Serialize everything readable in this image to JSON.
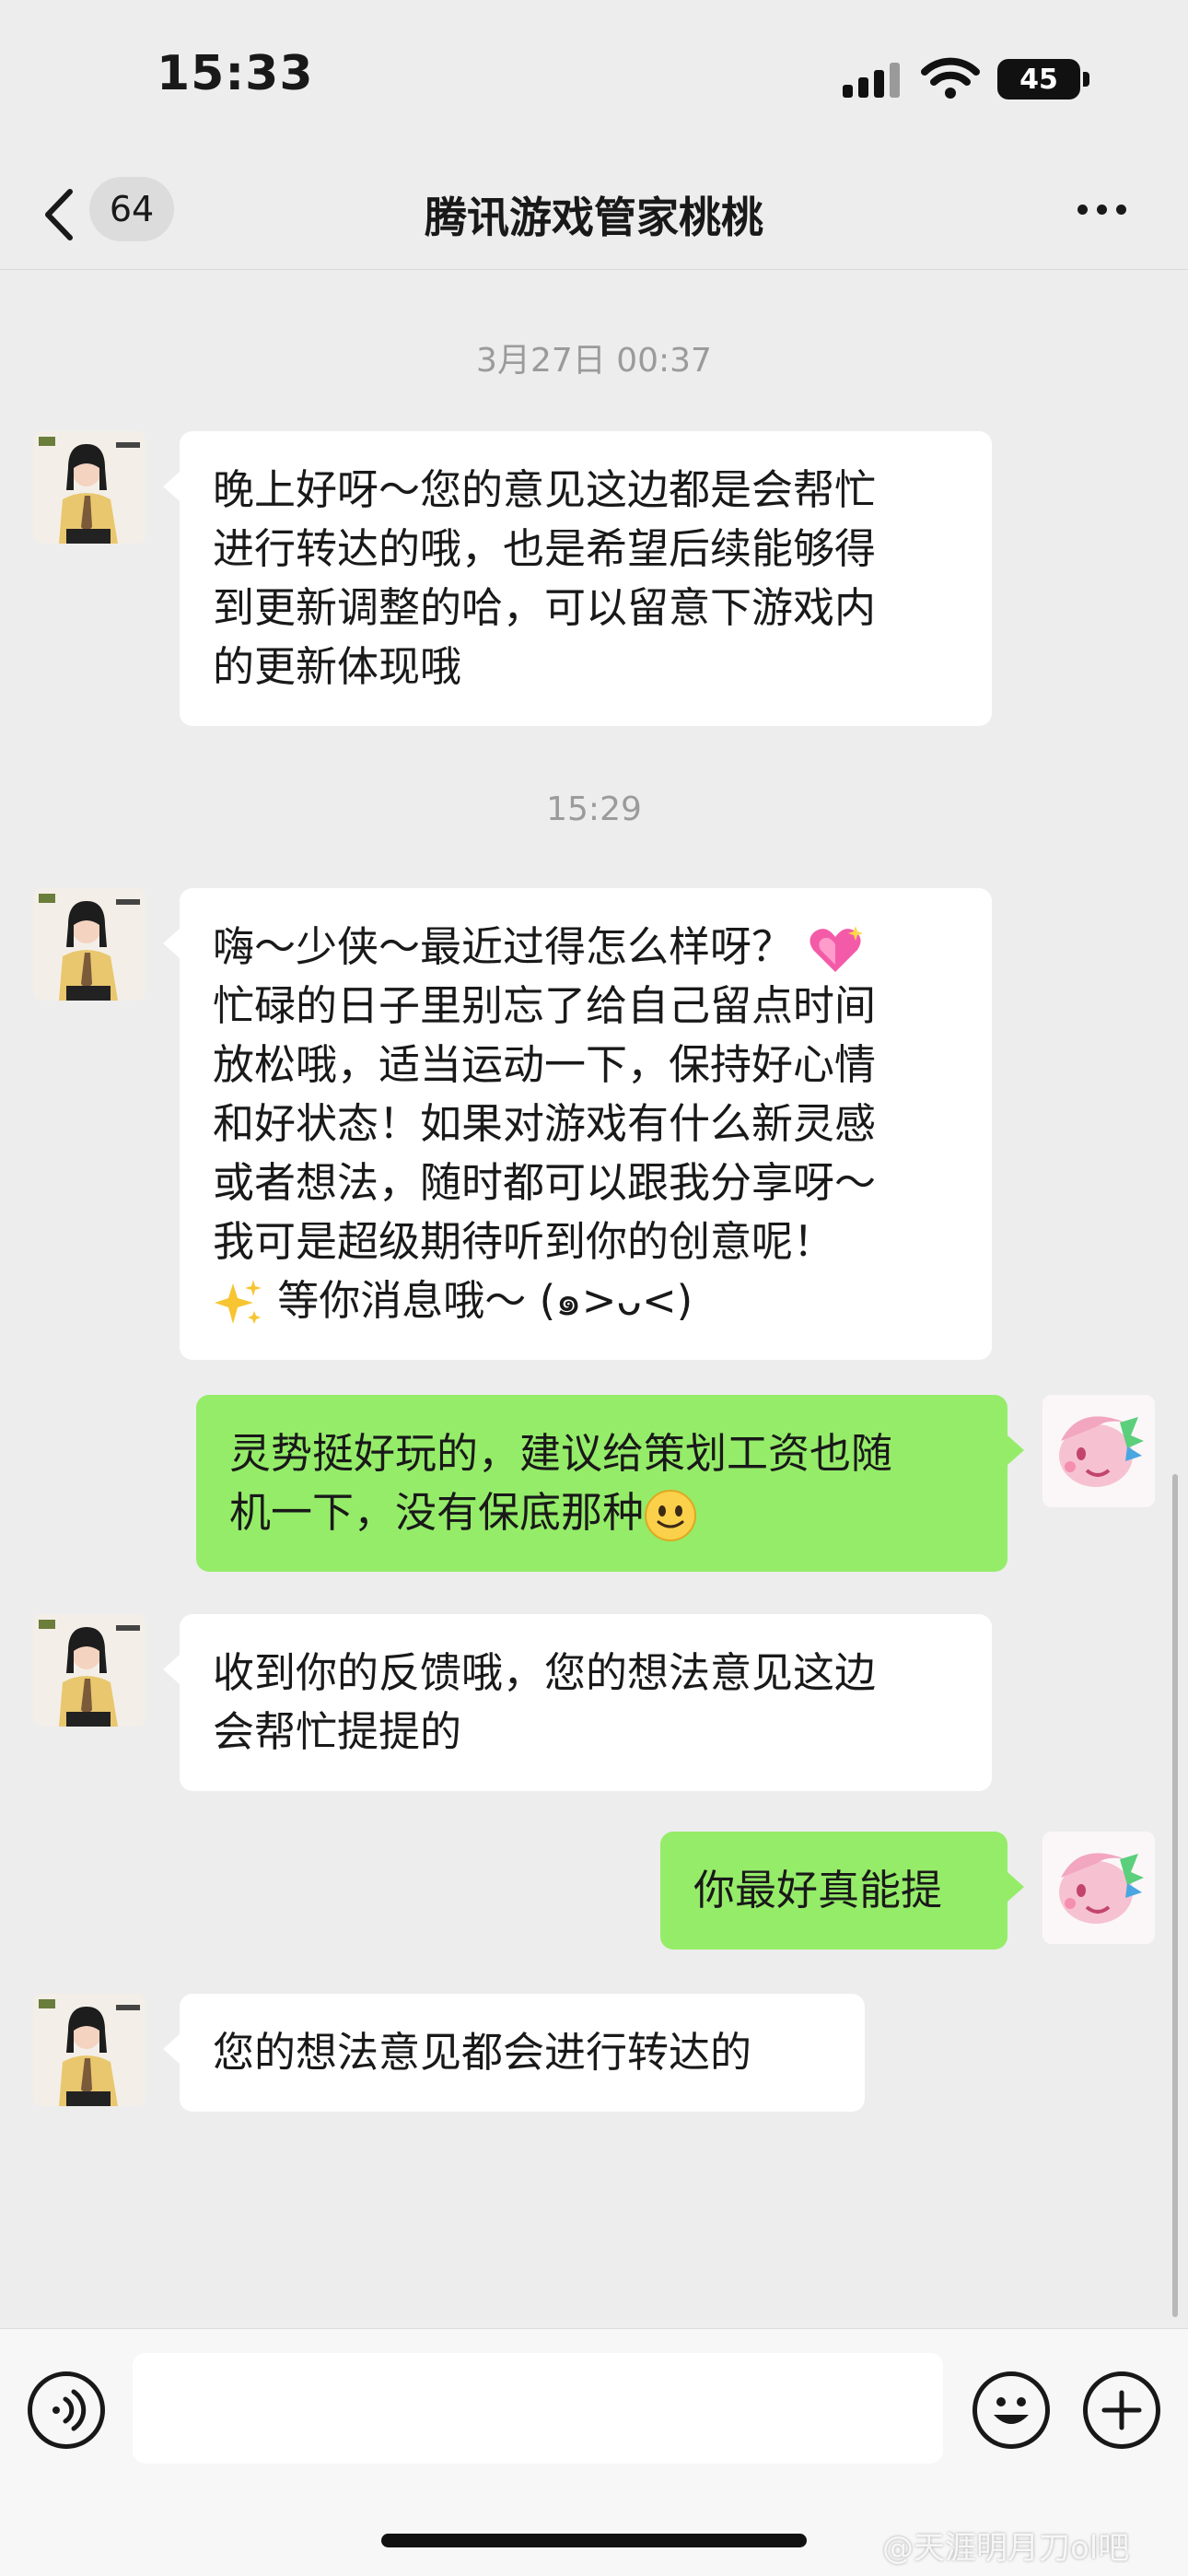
{
  "status_bar": {
    "time": "15:33",
    "battery": "45",
    "icons": [
      "signal-icon",
      "wifi-icon",
      "battery-icon"
    ]
  },
  "nav": {
    "unread_count": "64",
    "title": "腾讯游戏管家桃桃",
    "icons": [
      "chevron-left-icon",
      "more-dots-icon"
    ]
  },
  "timestamps": [
    "3月27日 00:37",
    "15:29"
  ],
  "messages": [
    {
      "from": "other",
      "text": "晚上好呀～您的意见这边都是会帮忙\n进行转达的哦，也是希望后续能够得\n到更新调整的哈，可以留意下游戏内\n的更新体现哦"
    },
    {
      "from": "other",
      "line1": "嗨～少侠～最近过得怎么样呀？",
      "body": "忙碌的日子里别忘了给自己留点时间\n放松哦，适当运动一下，保持好心情\n和好状态！如果对游戏有什么新灵感\n或者想法，随时都可以跟我分享呀～\n我可是超级期待听到你的创意呢！",
      "tail": " 等你消息哦～ (๑>ᴗ<)",
      "emojis": [
        "sparkling-heart-emoji",
        "sparkles-emoji"
      ]
    },
    {
      "from": "self",
      "text": "灵势挺好玩的，建议给策划工资也随\n机一下，没有保底那种",
      "emojis": [
        "smile-emoji"
      ]
    },
    {
      "from": "other",
      "text": "收到你的反馈哦，您的想法意见这边\n会帮忙提提的"
    },
    {
      "from": "self",
      "text": "你最好真能提"
    },
    {
      "from": "other",
      "text": "您的想法意见都会进行转达的"
    }
  ],
  "input_bar": {
    "value": "",
    "icons": [
      "voice-icon",
      "emoji-icon",
      "plus-icon"
    ]
  },
  "watermark": "@天涯明月刀ol吧",
  "colors": {
    "background": "#ededed",
    "incoming_bubble": "#ffffff",
    "outgoing_bubble": "#95ec69"
  }
}
